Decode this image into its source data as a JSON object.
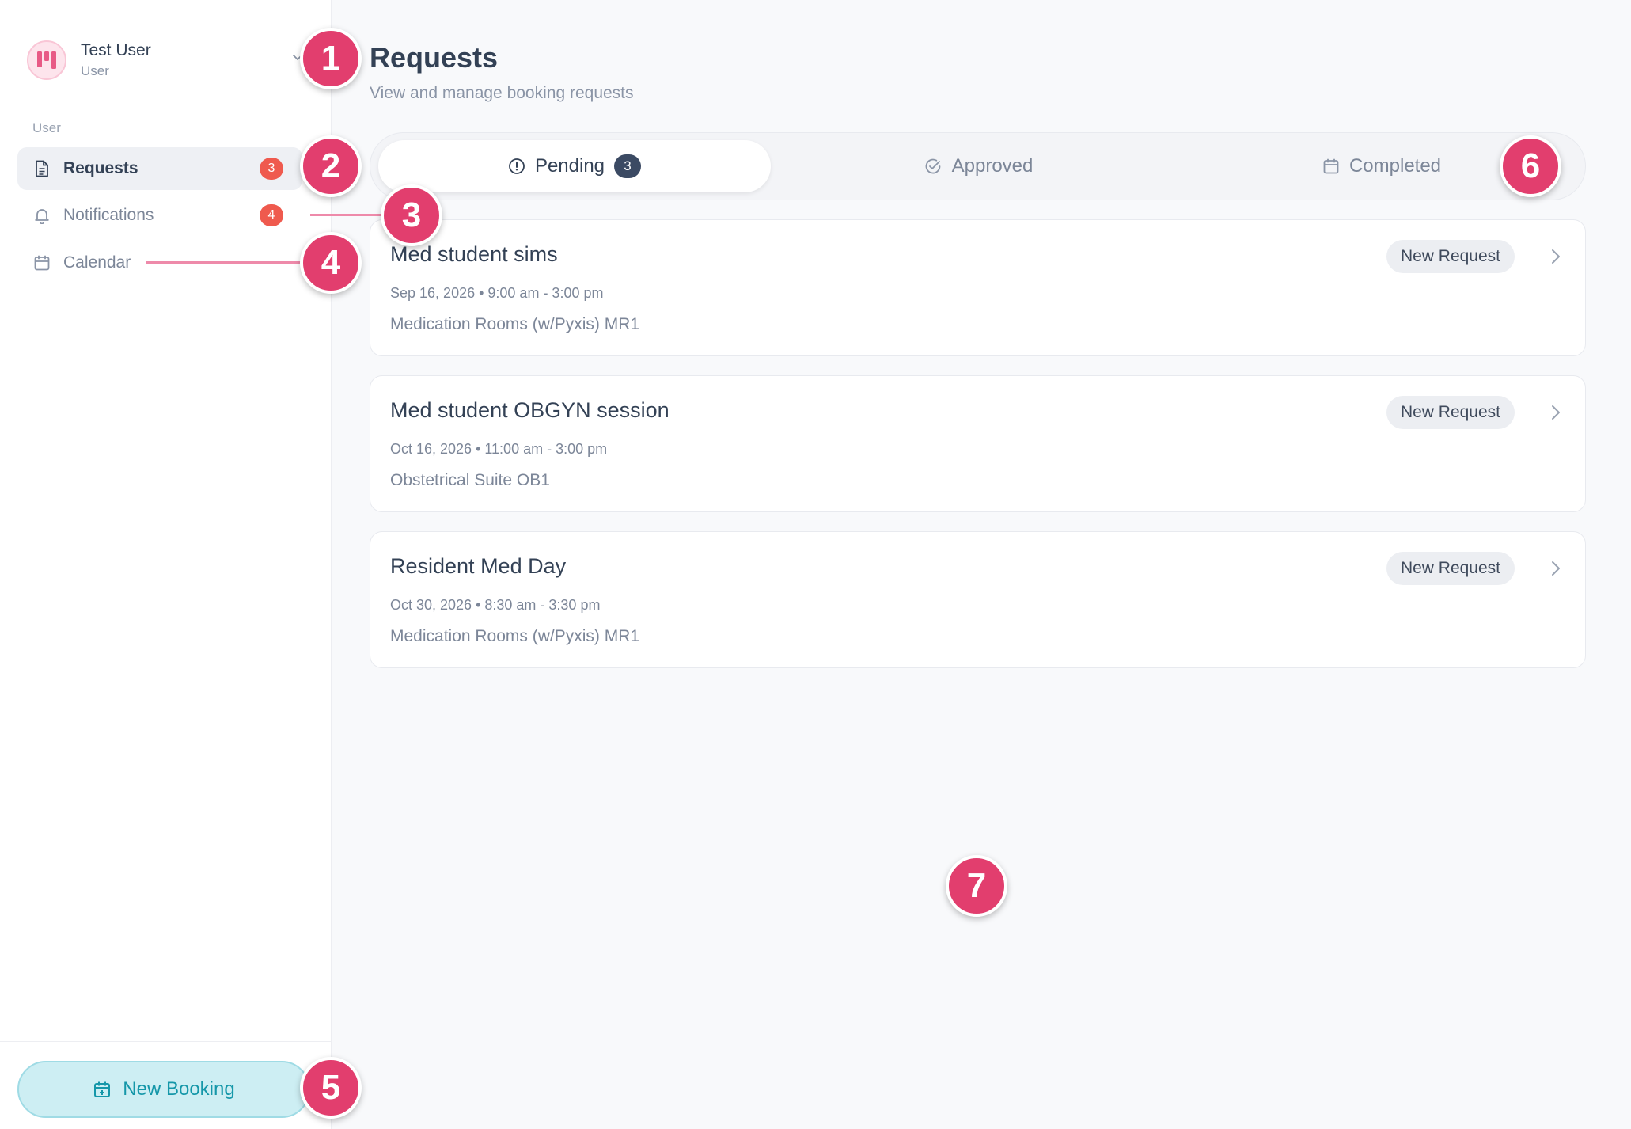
{
  "user": {
    "name": "Test User",
    "role": "User"
  },
  "sidebar": {
    "section_label": "User",
    "items": [
      {
        "label": "Requests",
        "badge": "3",
        "icon": "document-icon",
        "active": true
      },
      {
        "label": "Notifications",
        "badge": "4",
        "icon": "bell-icon",
        "active": false
      },
      {
        "label": "Calendar",
        "badge": null,
        "icon": "calendar-icon",
        "active": false
      }
    ],
    "new_booking_label": "New Booking"
  },
  "page": {
    "title": "Requests",
    "subtitle": "View and manage booking requests"
  },
  "tabs": [
    {
      "label": "Pending",
      "count": "3",
      "icon": "alert-circle-icon",
      "active": true
    },
    {
      "label": "Approved",
      "icon": "check-circle-icon",
      "active": false
    },
    {
      "label": "Completed",
      "icon": "calendar-icon",
      "active": false
    }
  ],
  "requests": [
    {
      "title": "Med student sims",
      "date": "Sep 16, 2026",
      "time": "9:00 am - 3:00 pm",
      "meta": "Sep 16, 2026 • 9:00 am - 3:00 pm",
      "location": "Medication Rooms (w/Pyxis) MR1",
      "status": "New Request"
    },
    {
      "title": "Med student OBGYN session",
      "date": "Oct 16, 2026",
      "time": "11:00 am - 3:00 pm",
      "meta": "Oct 16, 2026 • 11:00 am - 3:00 pm",
      "location": "Obstetrical Suite OB1",
      "status": "New Request"
    },
    {
      "title": "Resident Med Day",
      "date": "Oct 30, 2026",
      "time": "8:30 am - 3:30 pm",
      "meta": "Oct 30, 2026 • 8:30 am - 3:30 pm",
      "location": "Medication Rooms (w/Pyxis) MR1",
      "status": "New Request"
    }
  ],
  "markers": [
    "1",
    "2",
    "3",
    "4",
    "5",
    "6",
    "7"
  ],
  "colors": {
    "marker": "#e23e6e",
    "badge_red": "#ef5a4e",
    "accent_teal": "#1597a9",
    "tab_count_bg": "#3b4a63"
  }
}
